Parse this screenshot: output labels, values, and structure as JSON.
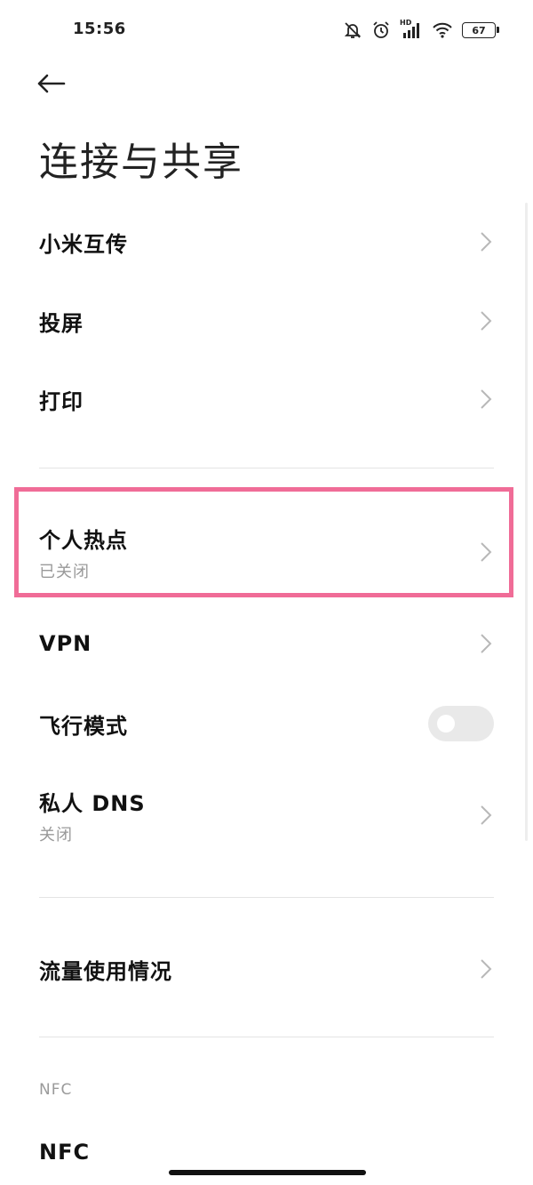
{
  "status_bar": {
    "time": "15:56",
    "hd_label": "HD",
    "battery": "67",
    "icons": [
      "bell-off-icon",
      "alarm-icon",
      "signal-icon",
      "wifi-icon",
      "battery-icon"
    ]
  },
  "header": {
    "back_icon": "back-arrow-icon",
    "title": "连接与共享"
  },
  "items": {
    "mi_share": {
      "label": "小米互传",
      "icon": "chevron-right-icon"
    },
    "cast": {
      "label": "投屏",
      "icon": "chevron-right-icon"
    },
    "print": {
      "label": "打印",
      "icon": "chevron-right-icon"
    },
    "hotspot": {
      "label": "个人热点",
      "status": "已关闭",
      "icon": "chevron-right-icon"
    },
    "vpn": {
      "label": "VPN",
      "icon": "chevron-right-icon"
    },
    "airplane": {
      "label": "飞行模式",
      "toggle_on": false
    },
    "private_dns": {
      "label": "私人 DNS",
      "status": "关闭",
      "icon": "chevron-right-icon"
    },
    "data_usage": {
      "label": "流量使用情况",
      "icon": "chevron-right-icon"
    },
    "nfc": {
      "label": "NFC"
    }
  },
  "sections": {
    "nfc_header": "NFC"
  },
  "colors": {
    "highlight": "#f06c97",
    "toggle_off": "#e9e9e9",
    "secondary_text": "#999999"
  }
}
